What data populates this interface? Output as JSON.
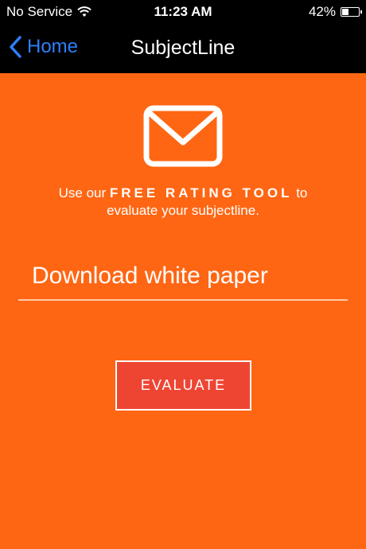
{
  "status_bar": {
    "carrier": "No Service",
    "time": "11:23 AM",
    "battery_percent_label": "42%",
    "battery_level": 0.42
  },
  "nav": {
    "back_label": "Home",
    "title": "SubjectLine"
  },
  "main": {
    "tagline_prefix": "Use our ",
    "tagline_emphasis": "FREE RATING TOOL",
    "tagline_suffix": " to evaluate your subjectline.",
    "subject_value": "Download white paper",
    "evaluate_label": "EVALUATE"
  },
  "colors": {
    "background": "#ff6613",
    "button": "#ee4533",
    "link": "#2d7ff9"
  },
  "icons": {
    "back": "chevron-left-icon",
    "wifi": "wifi-icon",
    "battery": "battery-icon",
    "hero": "envelope-icon"
  }
}
